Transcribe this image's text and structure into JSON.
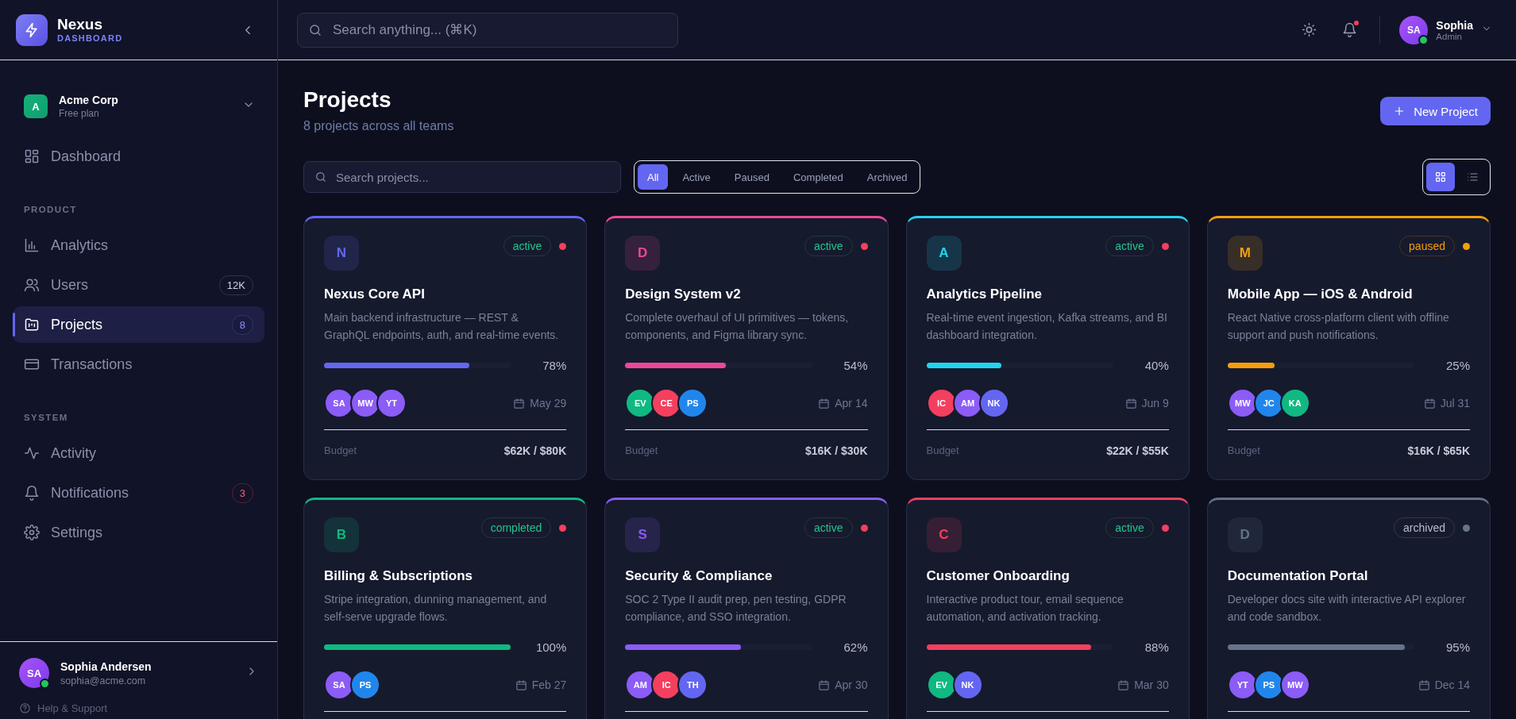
{
  "sidebar": {
    "brand": {
      "name": "Nexus",
      "tagline": "DASHBOARD"
    },
    "org": {
      "initial": "A",
      "name": "Acme Corp",
      "plan": "Free plan"
    },
    "nav": [
      {
        "items": [
          {
            "label": "Dashboard",
            "selected": false
          }
        ]
      },
      {
        "heading": "PRODUCT",
        "items": [
          {
            "label": "Analytics",
            "selected": false
          },
          {
            "label": "Users",
            "selected": false,
            "badge": {
              "text": "12K",
              "kind": "neutral"
            }
          },
          {
            "label": "Projects",
            "selected": true,
            "badge": {
              "text": "8",
              "kind": "accent"
            }
          },
          {
            "label": "Transactions",
            "selected": false
          }
        ]
      },
      {
        "heading": "SYSTEM",
        "items": [
          {
            "label": "Activity",
            "selected": false
          },
          {
            "label": "Notifications",
            "selected": false,
            "badge": {
              "text": "3",
              "kind": "alert"
            }
          },
          {
            "label": "Settings",
            "selected": false
          }
        ]
      }
    ],
    "user": {
      "initials": "SA",
      "name": "Sophia Andersen",
      "email": "sophia@acme.com",
      "online": true
    },
    "help": "Help & Support"
  },
  "topbar": {
    "search": {
      "placeholder": "Search anything... (⌘K)"
    },
    "unread": true,
    "user": {
      "initials": "SA",
      "name": "Sophia",
      "role": "Admin",
      "online": true
    }
  },
  "page": {
    "title": "Projects",
    "subtitle": "8 projects across all teams",
    "new_button": "New Project",
    "search": {
      "placeholder": "Search projects..."
    },
    "filters": [
      {
        "label": "All",
        "selected": true
      },
      {
        "label": "Active",
        "selected": false
      },
      {
        "label": "Paused",
        "selected": false
      },
      {
        "label": "Completed",
        "selected": false
      },
      {
        "label": "Archived",
        "selected": false
      }
    ],
    "views": [
      {
        "kind": "grid",
        "selected": true
      },
      {
        "kind": "list",
        "selected": false
      }
    ]
  },
  "projects": [
    {
      "initial": "N",
      "name": "Nexus Core API",
      "description": "Main backend infrastructure — REST & GraphQL endpoints, auth, and real-time events.",
      "color": "#6366f1",
      "status": {
        "label": "active",
        "kind": "ok"
      },
      "dot": {
        "color": "#f43f5e"
      },
      "level": 0.78,
      "percent": "78%",
      "members": [
        {
          "initials": "SA",
          "color": "#8b5cf6"
        },
        {
          "initials": "MW",
          "color": "#8b5cf6"
        },
        {
          "initials": "YT",
          "color": "#8b5cf6"
        }
      ],
      "due": "May 29",
      "budget_label": "Budget",
      "budget": "$62K / $80K"
    },
    {
      "initial": "D",
      "name": "Design System v2",
      "description": "Complete overhaul of UI primitives — tokens, components, and Figma library sync.",
      "color": "#ec4899",
      "status": {
        "label": "active",
        "kind": "ok"
      },
      "dot": {
        "color": "#f43f5e"
      },
      "level": 0.54,
      "percent": "54%",
      "members": [
        {
          "initials": "EV",
          "color": "#10b981"
        },
        {
          "initials": "CE",
          "color": "#f43f5e"
        },
        {
          "initials": "PS",
          "color": "#2186eb"
        }
      ],
      "due": "Apr 14",
      "budget_label": "Budget",
      "budget": "$16K / $30K"
    },
    {
      "initial": "A",
      "name": "Analytics Pipeline",
      "description": "Real-time event ingestion, Kafka streams, and BI dashboard integration.",
      "color": "#22d3ee",
      "status": {
        "label": "active",
        "kind": "ok"
      },
      "dot": {
        "color": "#f43f5e"
      },
      "level": 0.4,
      "percent": "40%",
      "members": [
        {
          "initials": "IC",
          "color": "#f43f5e"
        },
        {
          "initials": "AM",
          "color": "#8b5cf6"
        },
        {
          "initials": "NK",
          "color": "#6366f1"
        }
      ],
      "due": "Jun 9",
      "budget_label": "Budget",
      "budget": "$22K / $55K"
    },
    {
      "initial": "M",
      "name": "Mobile App — iOS & Android",
      "description": "React Native cross-platform client with offline support and push notifications.",
      "color": "#f59e0b",
      "status": {
        "label": "paused",
        "kind": "warn"
      },
      "dot": {
        "color": "#f59e0b"
      },
      "level": 0.25,
      "percent": "25%",
      "members": [
        {
          "initials": "MW",
          "color": "#8b5cf6"
        },
        {
          "initials": "JC",
          "color": "#2186eb"
        },
        {
          "initials": "KA",
          "color": "#10b981"
        }
      ],
      "due": "Jul 31",
      "budget_label": "Budget",
      "budget": "$16K / $65K"
    },
    {
      "initial": "B",
      "name": "Billing & Subscriptions",
      "description": "Stripe integration, dunning management, and self-serve upgrade flows.",
      "color": "#10b981",
      "status": {
        "label": "completed",
        "kind": "ok"
      },
      "dot": {
        "color": "#f43f5e"
      },
      "level": 1.0,
      "percent": "100%",
      "members": [
        {
          "initials": "SA",
          "color": "#8b5cf6"
        },
        {
          "initials": "PS",
          "color": "#2186eb"
        }
      ],
      "due": "Feb 27"
    },
    {
      "initial": "S",
      "name": "Security & Compliance",
      "description": "SOC 2 Type II audit prep, pen testing, GDPR compliance, and SSO integration.",
      "color": "#8b5cf6",
      "status": {
        "label": "active",
        "kind": "ok"
      },
      "dot": {
        "color": "#f43f5e"
      },
      "level": 0.62,
      "percent": "62%",
      "members": [
        {
          "initials": "AM",
          "color": "#8b5cf6"
        },
        {
          "initials": "IC",
          "color": "#f43f5e"
        },
        {
          "initials": "TH",
          "color": "#6366f1"
        }
      ],
      "due": "Apr 30"
    },
    {
      "initial": "C",
      "name": "Customer Onboarding",
      "description": "Interactive product tour, email sequence automation, and activation tracking.",
      "color": "#f43f5e",
      "status": {
        "label": "active",
        "kind": "ok"
      },
      "dot": {
        "color": "#f43f5e"
      },
      "level": 0.88,
      "percent": "88%",
      "members": [
        {
          "initials": "EV",
          "color": "#10b981"
        },
        {
          "initials": "NK",
          "color": "#6366f1"
        }
      ],
      "due": "Mar 30"
    },
    {
      "initial": "D",
      "name": "Documentation Portal",
      "description": "Developer docs site with interactive API explorer and code sandbox.",
      "color": "#64748b",
      "status": {
        "label": "archived",
        "kind": "muted"
      },
      "dot": {
        "color": "#64748b"
      },
      "level": 0.95,
      "percent": "95%",
      "members": [
        {
          "initials": "YT",
          "color": "#8b5cf6"
        },
        {
          "initials": "PS",
          "color": "#2186eb"
        },
        {
          "initials": "MW",
          "color": "#8b5cf6"
        }
      ],
      "due": "Dec 14"
    }
  ]
}
